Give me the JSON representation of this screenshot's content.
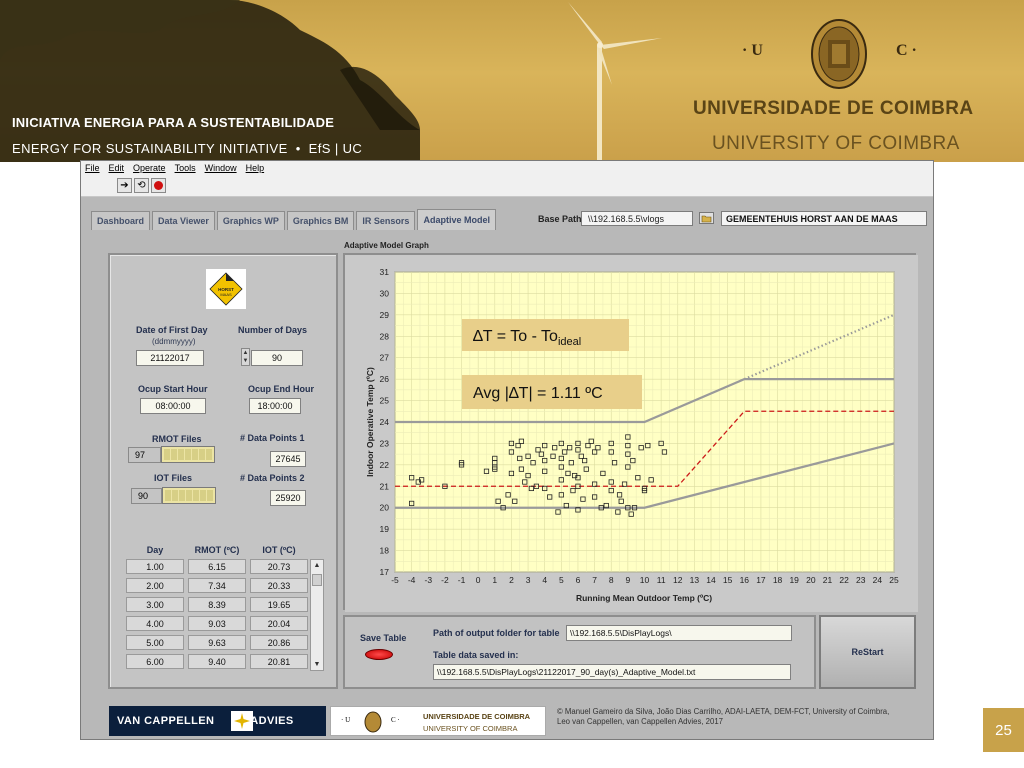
{
  "header": {
    "efs_line1": "INICIATIVA ENERGIA  PARA  A  SUSTENTABILIDADE",
    "efs_line2_a": "ENERGY  FOR  SUSTAINABILITY  INITIATIVE",
    "efs_line2_b": "EfS | UC",
    "uc_left": "· U",
    "uc_right": "C ·",
    "uc_title_pt": "UNIVERSIDADE  DE  COIMBRA",
    "uc_title_en": "UNIVERSITY  OF  COIMBRA"
  },
  "menu": [
    "File",
    "Edit",
    "Operate",
    "Tools",
    "Window",
    "Help"
  ],
  "tabs": [
    "Dashboard",
    "Data Viewer",
    "Graphics WP",
    "Graphics BM",
    "IR Sensors",
    "Adaptive Model"
  ],
  "active_tab": "Adaptive Model",
  "base_path": {
    "label": "Base Path",
    "value": "\\\\192.168.5.5\\vlogs"
  },
  "site_name": "GEMEENTEHUIS HORST AAN DE MAAS",
  "left": {
    "date_label": "Date of First Day",
    "date_format": "(ddmmyyyy)",
    "date_value": "21122017",
    "days_label": "Number of Days",
    "days_value": "90",
    "ocup_start_label": "Ocup Start Hour",
    "ocup_start_value": "08:00:00",
    "ocup_end_label": "Ocup End Hour",
    "ocup_end_value": "18:00:00",
    "rmot_files_label": "RMOT Files",
    "rmot_files_count": "97",
    "iot_files_label": "IOT Files",
    "iot_files_count": "90",
    "dp1_label": "# Data Points 1",
    "dp1_value": "27645",
    "dp2_label": "# Data Points 2",
    "dp2_value": "25920"
  },
  "table": {
    "headers": [
      "Day",
      "RMOT (ºC)",
      "IOT (ºC)"
    ],
    "rows": [
      [
        "1.00",
        "6.15",
        "20.73"
      ],
      [
        "2.00",
        "7.34",
        "20.33"
      ],
      [
        "3.00",
        "8.39",
        "19.65"
      ],
      [
        "4.00",
        "9.03",
        "20.04"
      ],
      [
        "5.00",
        "9.63",
        "20.86"
      ],
      [
        "6.00",
        "9.40",
        "20.81"
      ]
    ]
  },
  "graph_title": "Adaptive Model Graph",
  "chart_data": {
    "type": "scatter",
    "title": "",
    "xlabel": "Running Mean Outdoor Temp (ºC)",
    "ylabel": "Indoor Operative Temp (ºC)",
    "xlim": [
      -5,
      25
    ],
    "ylim": [
      17,
      31
    ],
    "xticks": [
      -5,
      -4,
      -3,
      -2,
      -1,
      0,
      1,
      2,
      3,
      4,
      5,
      6,
      7,
      8,
      9,
      10,
      11,
      12,
      13,
      14,
      15,
      16,
      17,
      18,
      19,
      20,
      21,
      22,
      23,
      24,
      25
    ],
    "yticks": [
      17,
      18,
      19,
      20,
      21,
      22,
      23,
      24,
      25,
      26,
      27,
      28,
      29,
      30,
      31
    ],
    "grid": true,
    "annotations": [
      {
        "text_main": "∆T = To - To",
        "text_sub": "ideal"
      },
      {
        "text": "Avg |∆T| = 1.11 ºC"
      }
    ],
    "lines": [
      {
        "name": "upper limit",
        "color": "#9a9a9a",
        "style": "solid",
        "x": [
          -5,
          10,
          16,
          25
        ],
        "y": [
          24,
          24,
          26,
          26
        ]
      },
      {
        "name": "upper limit extension",
        "color": "#9a9a9a",
        "style": "dotted",
        "x": [
          16,
          25
        ],
        "y": [
          26,
          29
        ]
      },
      {
        "name": "lower limit",
        "color": "#9a9a9a",
        "style": "solid",
        "x": [
          -5,
          10,
          25
        ],
        "y": [
          20,
          20,
          23
        ]
      },
      {
        "name": "ideal",
        "color": "#cc1a1a",
        "style": "dashed",
        "x": [
          -5,
          12,
          16,
          25
        ],
        "y": [
          21,
          21,
          24.5,
          24.5
        ]
      }
    ],
    "points": [
      [
        -4,
        20.2
      ],
      [
        -4,
        21.4
      ],
      [
        -3.6,
        21.2
      ],
      [
        -3.4,
        21.3
      ],
      [
        -2,
        21
      ],
      [
        -1,
        22.1
      ],
      [
        -1,
        22.0
      ],
      [
        1,
        21.9
      ],
      [
        1,
        22.1
      ],
      [
        1.2,
        20.3
      ],
      [
        1.5,
        20
      ],
      [
        0.5,
        21.7
      ],
      [
        1,
        21.8
      ],
      [
        1,
        22.3
      ],
      [
        2,
        23
      ],
      [
        2,
        22.6
      ],
      [
        2,
        21.6
      ],
      [
        2.4,
        22.9
      ],
      [
        2.5,
        22.3
      ],
      [
        2.6,
        23.1
      ],
      [
        2.6,
        21.8
      ],
      [
        3,
        22.4
      ],
      [
        3,
        21.5
      ],
      [
        3.5,
        21
      ],
      [
        3.6,
        22.7
      ],
      [
        3.8,
        22.5
      ],
      [
        4,
        22.9
      ],
      [
        4,
        22.2
      ],
      [
        4,
        21.7
      ],
      [
        4,
        20.9
      ],
      [
        4.3,
        20.5
      ],
      [
        4.5,
        22.4
      ],
      [
        4.6,
        22.8
      ],
      [
        5,
        23
      ],
      [
        5,
        22.3
      ],
      [
        5,
        21.9
      ],
      [
        5,
        21.3
      ],
      [
        5,
        20.6
      ],
      [
        5.2,
        22.6
      ],
      [
        5.4,
        21.6
      ],
      [
        5.5,
        22.8
      ],
      [
        5.6,
        22.1
      ],
      [
        5.7,
        20.8
      ],
      [
        5.8,
        21.5
      ],
      [
        6,
        23
      ],
      [
        6,
        22.7
      ],
      [
        6,
        21.4
      ],
      [
        6,
        21
      ],
      [
        6,
        19.9
      ],
      [
        6.2,
        22.4
      ],
      [
        6.3,
        20.4
      ],
      [
        6.5,
        21.8
      ],
      [
        6.6,
        22.9
      ],
      [
        7,
        22.6
      ],
      [
        7,
        21.1
      ],
      [
        7,
        20.5
      ],
      [
        7.2,
        22.8
      ],
      [
        7.5,
        21.6
      ],
      [
        7.7,
        20.1
      ],
      [
        8,
        23
      ],
      [
        8,
        22.6
      ],
      [
        8,
        21.2
      ],
      [
        8,
        20.8
      ],
      [
        8.2,
        22.1
      ],
      [
        8.4,
        19.8
      ],
      [
        8.5,
        20.6
      ],
      [
        8.6,
        20.3
      ],
      [
        9,
        23.3
      ],
      [
        9,
        22.9
      ],
      [
        9,
        22.5
      ],
      [
        9,
        21.9
      ],
      [
        9,
        20
      ],
      [
        9.2,
        19.7
      ],
      [
        9.4,
        20
      ],
      [
        9.6,
        21.4
      ],
      [
        9.8,
        22.8
      ],
      [
        10,
        20.9
      ],
      [
        10,
        20.8
      ],
      [
        10.2,
        22.9
      ],
      [
        10.4,
        21.3
      ],
      [
        11,
        23
      ],
      [
        11.2,
        22.6
      ],
      [
        6.8,
        23.1
      ],
      [
        3.2,
        20.9
      ],
      [
        2.2,
        20.3
      ],
      [
        7.4,
        20
      ],
      [
        4.8,
        19.8
      ],
      [
        1.8,
        20.6
      ],
      [
        8.8,
        21.1
      ],
      [
        6.4,
        22.2
      ],
      [
        5.3,
        20.1
      ],
      [
        3.3,
        22.1
      ],
      [
        9.3,
        22.2
      ],
      [
        2.8,
        21.2
      ]
    ]
  },
  "bottom": {
    "save_table_label": "Save Table",
    "path_label": "Path of output folder for table",
    "path_value": "\\\\192.168.5.5\\DisPlayLogs\\",
    "saved_label": "Table data saved in:",
    "saved_value": "\\\\192.168.5.5\\DisPlayLogs\\21122017_90_day(s)_Adaptive_Model.txt",
    "restart_label": "ReStart"
  },
  "footer": {
    "vcl_left": "VAN CAPPELLEN",
    "vcl_right": "ADVIES",
    "uc_pt": "UNIVERSIDADE DE COIMBRA",
    "uc_en": "UNIVERSITY OF COIMBRA",
    "credits_1": "© Manuel Gameiro da Silva, João Dias Carrilho, ADAI-LAETA, DEM-FCT, University of Coimbra,",
    "credits_2": "Leo van Cappellen, van Cappellen Advies, 2017"
  },
  "page_number": "25"
}
